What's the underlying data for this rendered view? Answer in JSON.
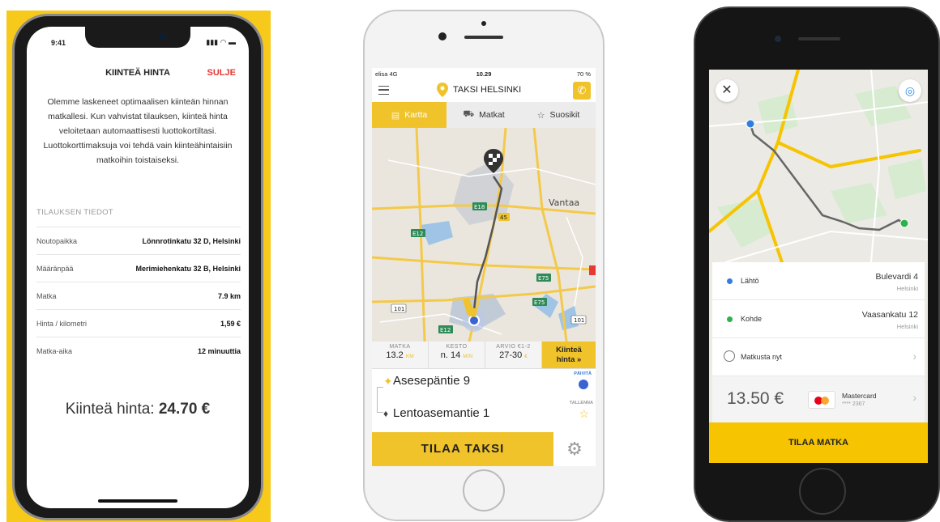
{
  "phone1": {
    "time": "9:41",
    "title": "KIINTEÄ HINTA",
    "close_label": "SULJE",
    "description": "Olemme laskeneet optimaalisen kiinteän hinnan matkallesi. Kun vahvistat tilauksen, kiinteä hinta veloitetaan automaattisesti luottokortiltasi. Luottokorttimaksuja voi tehdä vain kiinteähintaisiin matkoihin toistaiseksi.",
    "section_title": "TILAUKSEN TIEDOT",
    "rows": [
      {
        "label": "Noutopaikka",
        "value": "Lönnrotinkatu 32 D, Helsinki"
      },
      {
        "label": "Määränpää",
        "value": "Merimiehenkatu 32 B, Helsinki"
      },
      {
        "label": "Matka",
        "value": "7.9 km"
      },
      {
        "label": "Hinta / kilometri",
        "value": "1,59 €"
      },
      {
        "label": "Matka-aika",
        "value": "12 minuuttia"
      }
    ],
    "price_label": "Kiinteä hinta:",
    "price_value": "24.70 €"
  },
  "phone2": {
    "carrier": "elisa 4G",
    "time": "10.29",
    "battery": "70 %",
    "app_title": "TAKSI HELSINKI",
    "tabs": [
      {
        "label": "Kartta",
        "icon": "map-icon",
        "active": true
      },
      {
        "label": "Matkat",
        "icon": "car-icon",
        "active": false
      },
      {
        "label": "Suosikit",
        "icon": "star-icon",
        "active": false
      }
    ],
    "map_labels": {
      "city": "Vantaa",
      "e18": "E18",
      "r45": "45",
      "e12": "E12",
      "e75": "E75",
      "e75b": "E75",
      "r101": "101",
      "r101b": "101",
      "e12b": "E12"
    },
    "stats": [
      {
        "label": "MATKA",
        "value": "13.2",
        "unit": "KM"
      },
      {
        "label": "KESTO",
        "value": "n. 14",
        "unit": "MIN"
      },
      {
        "label": "ARVIO €1-2",
        "value": "27-30",
        "unit": "€"
      }
    ],
    "fixed_price_line1": "Kiinteä",
    "fixed_price_line2": "hinta »",
    "from_address": "Asesepäntie 9",
    "to_address": "Lentoasemantie 1",
    "refresh_label": "PÄIVITÄ",
    "save_label": "TALLENNA",
    "order_label": "TILAA TAKSI"
  },
  "phone3": {
    "from_label": "Lähtö",
    "from_address": "Bulevardi 4",
    "from_city": "Helsinki",
    "to_label": "Kohde",
    "to_address": "Vaasankatu 12",
    "to_city": "Helsinki",
    "time_label": "Matkusta nyt",
    "price": "13.50 €",
    "card_name": "Mastercard",
    "card_number": "**** 2367",
    "order_label": "TILAA MATKA"
  },
  "colors": {
    "yellow": "#f0c32a",
    "blue": "#3a63d1",
    "green": "#2bb34a",
    "red": "#e53935"
  }
}
